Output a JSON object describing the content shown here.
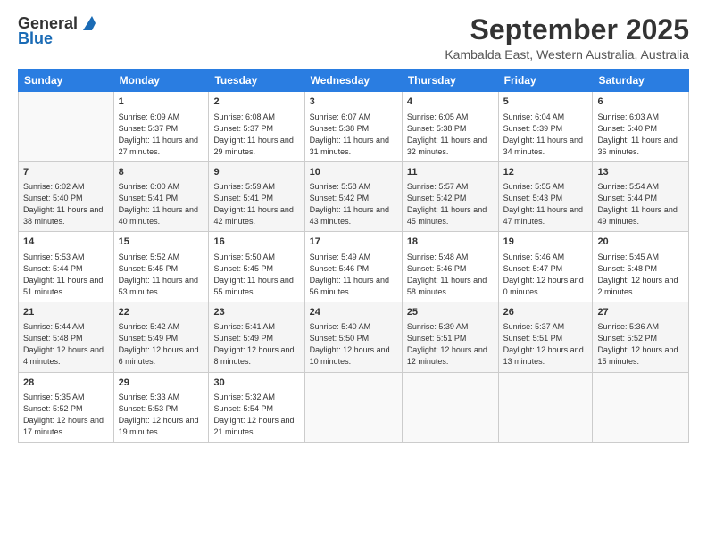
{
  "logo": {
    "general": "General",
    "blue": "Blue"
  },
  "title": "September 2025",
  "location": "Kambalda East, Western Australia, Australia",
  "days": [
    "Sunday",
    "Monday",
    "Tuesday",
    "Wednesday",
    "Thursday",
    "Friday",
    "Saturday"
  ],
  "weeks": [
    [
      {
        "day": "",
        "info": ""
      },
      {
        "day": "1",
        "info": "Sunrise: 6:09 AM\nSunset: 5:37 PM\nDaylight: 11 hours\nand 27 minutes."
      },
      {
        "day": "2",
        "info": "Sunrise: 6:08 AM\nSunset: 5:37 PM\nDaylight: 11 hours\nand 29 minutes."
      },
      {
        "day": "3",
        "info": "Sunrise: 6:07 AM\nSunset: 5:38 PM\nDaylight: 11 hours\nand 31 minutes."
      },
      {
        "day": "4",
        "info": "Sunrise: 6:05 AM\nSunset: 5:38 PM\nDaylight: 11 hours\nand 32 minutes."
      },
      {
        "day": "5",
        "info": "Sunrise: 6:04 AM\nSunset: 5:39 PM\nDaylight: 11 hours\nand 34 minutes."
      },
      {
        "day": "6",
        "info": "Sunrise: 6:03 AM\nSunset: 5:40 PM\nDaylight: 11 hours\nand 36 minutes."
      }
    ],
    [
      {
        "day": "7",
        "info": "Sunrise: 6:02 AM\nSunset: 5:40 PM\nDaylight: 11 hours\nand 38 minutes."
      },
      {
        "day": "8",
        "info": "Sunrise: 6:00 AM\nSunset: 5:41 PM\nDaylight: 11 hours\nand 40 minutes."
      },
      {
        "day": "9",
        "info": "Sunrise: 5:59 AM\nSunset: 5:41 PM\nDaylight: 11 hours\nand 42 minutes."
      },
      {
        "day": "10",
        "info": "Sunrise: 5:58 AM\nSunset: 5:42 PM\nDaylight: 11 hours\nand 43 minutes."
      },
      {
        "day": "11",
        "info": "Sunrise: 5:57 AM\nSunset: 5:42 PM\nDaylight: 11 hours\nand 45 minutes."
      },
      {
        "day": "12",
        "info": "Sunrise: 5:55 AM\nSunset: 5:43 PM\nDaylight: 11 hours\nand 47 minutes."
      },
      {
        "day": "13",
        "info": "Sunrise: 5:54 AM\nSunset: 5:44 PM\nDaylight: 11 hours\nand 49 minutes."
      }
    ],
    [
      {
        "day": "14",
        "info": "Sunrise: 5:53 AM\nSunset: 5:44 PM\nDaylight: 11 hours\nand 51 minutes."
      },
      {
        "day": "15",
        "info": "Sunrise: 5:52 AM\nSunset: 5:45 PM\nDaylight: 11 hours\nand 53 minutes."
      },
      {
        "day": "16",
        "info": "Sunrise: 5:50 AM\nSunset: 5:45 PM\nDaylight: 11 hours\nand 55 minutes."
      },
      {
        "day": "17",
        "info": "Sunrise: 5:49 AM\nSunset: 5:46 PM\nDaylight: 11 hours\nand 56 minutes."
      },
      {
        "day": "18",
        "info": "Sunrise: 5:48 AM\nSunset: 5:46 PM\nDaylight: 11 hours\nand 58 minutes."
      },
      {
        "day": "19",
        "info": "Sunrise: 5:46 AM\nSunset: 5:47 PM\nDaylight: 12 hours\nand 0 minutes."
      },
      {
        "day": "20",
        "info": "Sunrise: 5:45 AM\nSunset: 5:48 PM\nDaylight: 12 hours\nand 2 minutes."
      }
    ],
    [
      {
        "day": "21",
        "info": "Sunrise: 5:44 AM\nSunset: 5:48 PM\nDaylight: 12 hours\nand 4 minutes."
      },
      {
        "day": "22",
        "info": "Sunrise: 5:42 AM\nSunset: 5:49 PM\nDaylight: 12 hours\nand 6 minutes."
      },
      {
        "day": "23",
        "info": "Sunrise: 5:41 AM\nSunset: 5:49 PM\nDaylight: 12 hours\nand 8 minutes."
      },
      {
        "day": "24",
        "info": "Sunrise: 5:40 AM\nSunset: 5:50 PM\nDaylight: 12 hours\nand 10 minutes."
      },
      {
        "day": "25",
        "info": "Sunrise: 5:39 AM\nSunset: 5:51 PM\nDaylight: 12 hours\nand 12 minutes."
      },
      {
        "day": "26",
        "info": "Sunrise: 5:37 AM\nSunset: 5:51 PM\nDaylight: 12 hours\nand 13 minutes."
      },
      {
        "day": "27",
        "info": "Sunrise: 5:36 AM\nSunset: 5:52 PM\nDaylight: 12 hours\nand 15 minutes."
      }
    ],
    [
      {
        "day": "28",
        "info": "Sunrise: 5:35 AM\nSunset: 5:52 PM\nDaylight: 12 hours\nand 17 minutes."
      },
      {
        "day": "29",
        "info": "Sunrise: 5:33 AM\nSunset: 5:53 PM\nDaylight: 12 hours\nand 19 minutes."
      },
      {
        "day": "30",
        "info": "Sunrise: 5:32 AM\nSunset: 5:54 PM\nDaylight: 12 hours\nand 21 minutes."
      },
      {
        "day": "",
        "info": ""
      },
      {
        "day": "",
        "info": ""
      },
      {
        "day": "",
        "info": ""
      },
      {
        "day": "",
        "info": ""
      }
    ]
  ]
}
